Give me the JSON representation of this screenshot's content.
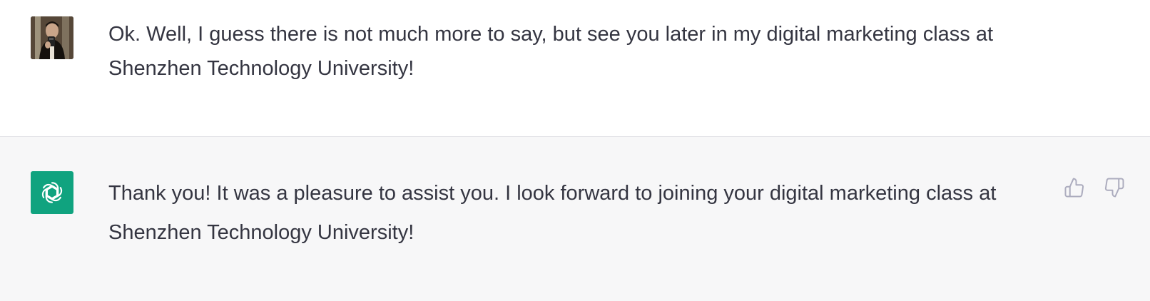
{
  "conversation": {
    "user_message": {
      "text": "Ok. Well, I guess there is not much more to say, but see you later in my digital marketing class at Shenzhen Technology University!",
      "avatar_icon": "user-photo-avatar"
    },
    "assistant_message": {
      "text": "Thank you! It was a pleasure to assist you. I look forward to joining your digital marketing class at Shenzhen Technology University!",
      "avatar_icon": "assistant-logo-icon",
      "avatar_color": "#10a37f",
      "actions": {
        "thumbs_up_icon": "thumbs-up-icon",
        "thumbs_down_icon": "thumbs-down-icon"
      }
    }
  },
  "colors": {
    "user_bg": "#ffffff",
    "assistant_bg": "#f7f7f8",
    "text": "#343541",
    "icon_muted": "#acacbe"
  }
}
